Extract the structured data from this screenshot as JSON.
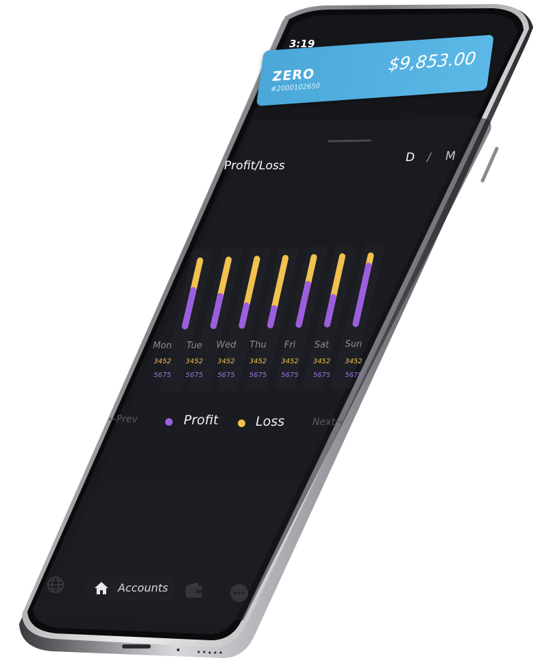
{
  "status_bar": {
    "time": "3:19"
  },
  "balance_card": {
    "brand": "ZERO",
    "account_number": "#2000102650",
    "amount": "$9,853.00",
    "color": "#4aa7d8"
  },
  "chart_section": {
    "title": "Profit/Loss",
    "period_options": [
      "D",
      "/",
      "M"
    ]
  },
  "chart_data": {
    "type": "bar",
    "categories": [
      "Mon",
      "Tue",
      "Wed",
      "Thu",
      "Fri",
      "Sat",
      "Sun"
    ],
    "series": [
      {
        "name": "Profit",
        "values": [
          5675,
          5675,
          5675,
          5675,
          5675,
          5675,
          5675
        ],
        "labels": [
          "5675",
          "5675",
          "5675",
          "5675",
          "5675",
          "5675",
          "5675"
        ],
        "color": "#9b5ee0"
      },
      {
        "name": "Loss",
        "values": [
          3452,
          3452,
          3452,
          3452,
          3452,
          3452,
          3452
        ],
        "labels": [
          "3452",
          "3452",
          "3452",
          "3452",
          "3452",
          "3452",
          "3452"
        ],
        "color": "#f2c14e"
      }
    ],
    "profit_fraction_shown": [
      0.55,
      0.45,
      0.3,
      0.25,
      0.6,
      0.4,
      0.85
    ]
  },
  "legend": {
    "profit_label": "Profit",
    "loss_label": "Loss",
    "profit_color": "#9b5ee0",
    "loss_color": "#f2c14e"
  },
  "pager": {
    "prev_label": "Prev",
    "next_label": "Next"
  },
  "bottom_nav": {
    "items": [
      {
        "icon": "globe-icon",
        "label": ""
      },
      {
        "icon": "home-icon",
        "label": "Accounts"
      },
      {
        "icon": "wallet-icon",
        "label": ""
      },
      {
        "icon": "more-icon",
        "label": ""
      }
    ]
  }
}
